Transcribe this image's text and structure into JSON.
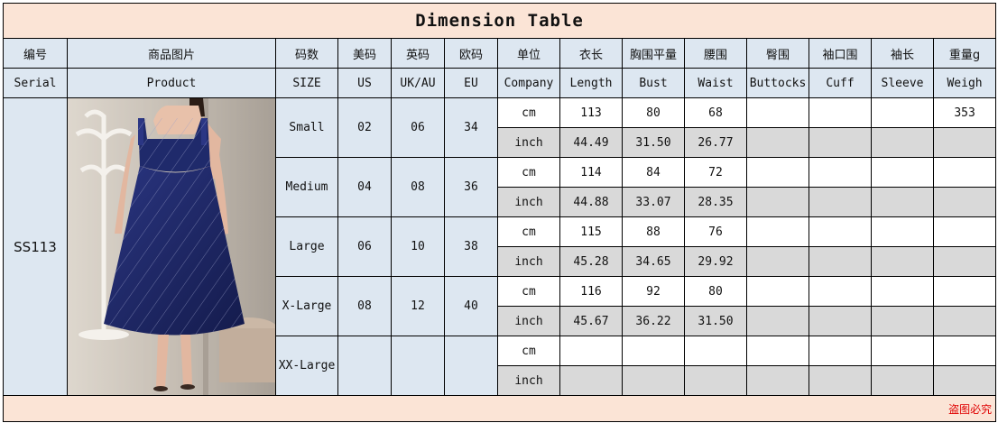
{
  "title": "Dimension Table",
  "header_cn": [
    "编号",
    "商品图片",
    "码数",
    "美码",
    "英码",
    "欧码",
    "单位",
    "衣长",
    "胸围平量",
    "腰围",
    "臀围",
    "袖口围",
    "袖长",
    "重量g"
  ],
  "header_en": [
    "Serial",
    "Product",
    "SIZE",
    "US",
    "UK/AU",
    "EU",
    "Company",
    "Length",
    "Bust",
    "Waist",
    "Buttocks",
    "Cuff",
    "Sleeve",
    "Weigh"
  ],
  "serial": "SS113",
  "product_image": "navy-blue-glitter-tea-length-dress-photo",
  "sizes": [
    {
      "size": "Small",
      "us": "02",
      "uk": "06",
      "eu": "34",
      "cm": {
        "unit": "cm",
        "length": "113",
        "bust": "80",
        "waist": "68",
        "buttocks": "",
        "cuff": "",
        "sleeve": "",
        "weight": "353"
      },
      "inch": {
        "unit": "inch",
        "length": "44.49",
        "bust": "31.50",
        "waist": "26.77",
        "buttocks": "",
        "cuff": "",
        "sleeve": "",
        "weight": ""
      }
    },
    {
      "size": "Medium",
      "us": "04",
      "uk": "08",
      "eu": "36",
      "cm": {
        "unit": "cm",
        "length": "114",
        "bust": "84",
        "waist": "72",
        "buttocks": "",
        "cuff": "",
        "sleeve": "",
        "weight": ""
      },
      "inch": {
        "unit": "inch",
        "length": "44.88",
        "bust": "33.07",
        "waist": "28.35",
        "buttocks": "",
        "cuff": "",
        "sleeve": "",
        "weight": ""
      }
    },
    {
      "size": "Large",
      "us": "06",
      "uk": "10",
      "eu": "38",
      "cm": {
        "unit": "cm",
        "length": "115",
        "bust": "88",
        "waist": "76",
        "buttocks": "",
        "cuff": "",
        "sleeve": "",
        "weight": ""
      },
      "inch": {
        "unit": "inch",
        "length": "45.28",
        "bust": "34.65",
        "waist": "29.92",
        "buttocks": "",
        "cuff": "",
        "sleeve": "",
        "weight": ""
      }
    },
    {
      "size": "X-Large",
      "us": "08",
      "uk": "12",
      "eu": "40",
      "cm": {
        "unit": "cm",
        "length": "116",
        "bust": "92",
        "waist": "80",
        "buttocks": "",
        "cuff": "",
        "sleeve": "",
        "weight": ""
      },
      "inch": {
        "unit": "inch",
        "length": "45.67",
        "bust": "36.22",
        "waist": "31.50",
        "buttocks": "",
        "cuff": "",
        "sleeve": "",
        "weight": ""
      }
    },
    {
      "size": "XX-Large",
      "us": "",
      "uk": "",
      "eu": "",
      "cm": {
        "unit": "cm",
        "length": "",
        "bust": "",
        "waist": "",
        "buttocks": "",
        "cuff": "",
        "sleeve": "",
        "weight": ""
      },
      "inch": {
        "unit": "inch",
        "length": "",
        "bust": "",
        "waist": "",
        "buttocks": "",
        "cuff": "",
        "sleeve": "",
        "weight": ""
      }
    }
  ],
  "footer_note": "盗图必究",
  "colors": {
    "title_bg": "#fbe4d6",
    "header_bg": "#dde7f1",
    "grey_row": "#d9d9d9",
    "footer_text": "#e00000",
    "dress": "#1f2a6b"
  }
}
